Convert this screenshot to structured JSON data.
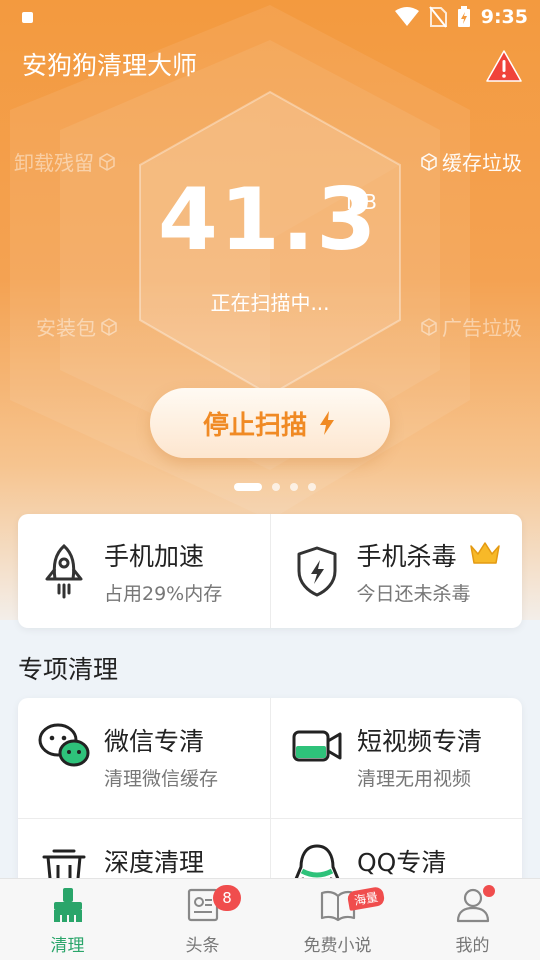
{
  "status_bar": {
    "time": "9:35"
  },
  "app": {
    "title": "安狗狗清理大师"
  },
  "scan": {
    "categories": {
      "uninstall_residue": "卸载残留",
      "cache_junk": "缓存垃圾",
      "apk": "安装包",
      "ad_junk": "广告垃圾"
    },
    "size_value": "41.3",
    "size_unit": "MB",
    "status": "正在扫描中...",
    "stop_button": "停止扫描"
  },
  "pager": {
    "count": 4,
    "active": 0
  },
  "quick_actions": [
    {
      "title": "手机加速",
      "subtitle": "占用29%内存",
      "icon": "rocket-icon"
    },
    {
      "title": "手机杀毒",
      "subtitle": "今日还未杀毒",
      "icon": "shield-bolt-icon",
      "badge_icon": "crown-icon"
    }
  ],
  "special": {
    "title": "专项清理",
    "items": [
      {
        "title": "微信专清",
        "subtitle": "清理微信缓存",
        "icon": "wechat-icon"
      },
      {
        "title": "短视频专清",
        "subtitle": "清理无用视频",
        "icon": "video-camera-icon"
      },
      {
        "title": "深度清理",
        "subtitle": "",
        "icon": "trash-icon"
      },
      {
        "title": "QQ专清",
        "subtitle": "",
        "icon": "qq-icon"
      }
    ]
  },
  "tabs": [
    {
      "label": "清理",
      "icon": "broom-icon",
      "active": true
    },
    {
      "label": "头条",
      "icon": "news-icon",
      "badge": "8"
    },
    {
      "label": "免费小说",
      "icon": "book-icon",
      "tag": "海量"
    },
    {
      "label": "我的",
      "icon": "user-icon",
      "dot": true
    }
  ],
  "colors": {
    "accent": "#f39a3f",
    "green": "#2aa56a",
    "badge_red": "#f04d4d"
  }
}
